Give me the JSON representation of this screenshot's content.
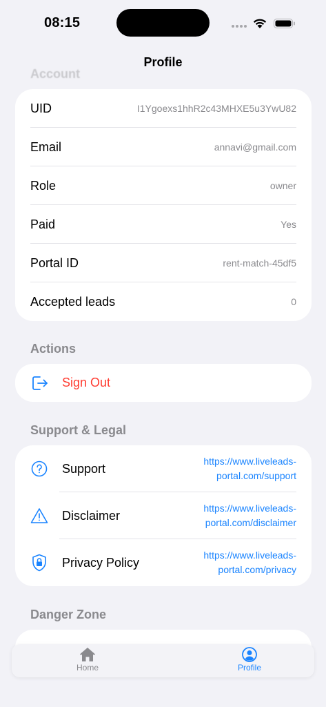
{
  "status_bar": {
    "time": "08:15"
  },
  "nav": {
    "title": "Profile"
  },
  "sections": {
    "account": "Account",
    "actions": "Actions",
    "support": "Support & Legal",
    "danger": "Danger Zone"
  },
  "account_rows": [
    {
      "label": "UID",
      "value": "I1Ygoexs1hhR2c43MHXE5u3YwU82"
    },
    {
      "label": "Email",
      "value": "annavi@gmail.com"
    },
    {
      "label": "Role",
      "value": "owner"
    },
    {
      "label": "Paid",
      "value": "Yes"
    },
    {
      "label": "Portal ID",
      "value": "rent-match-45df5"
    },
    {
      "label": "Accepted leads",
      "value": "0"
    }
  ],
  "actions": {
    "sign_out": "Sign Out"
  },
  "support_rows": [
    {
      "label": "Support",
      "value": "https://www.liveleads-portal.com/support",
      "icon": "question-circle-icon"
    },
    {
      "label": "Disclaimer",
      "value": "https://www.liveleads-portal.com/disclaimer",
      "icon": "warning-triangle-icon"
    },
    {
      "label": "Privacy Policy",
      "value": "https://www.liveleads-portal.com/privacy",
      "icon": "shield-lock-icon"
    }
  ],
  "tab_bar": {
    "home": "Home",
    "profile": "Profile"
  },
  "colors": {
    "accent": "#1a84ff",
    "destructive": "#ff3b30",
    "background": "#f2f2f7"
  }
}
